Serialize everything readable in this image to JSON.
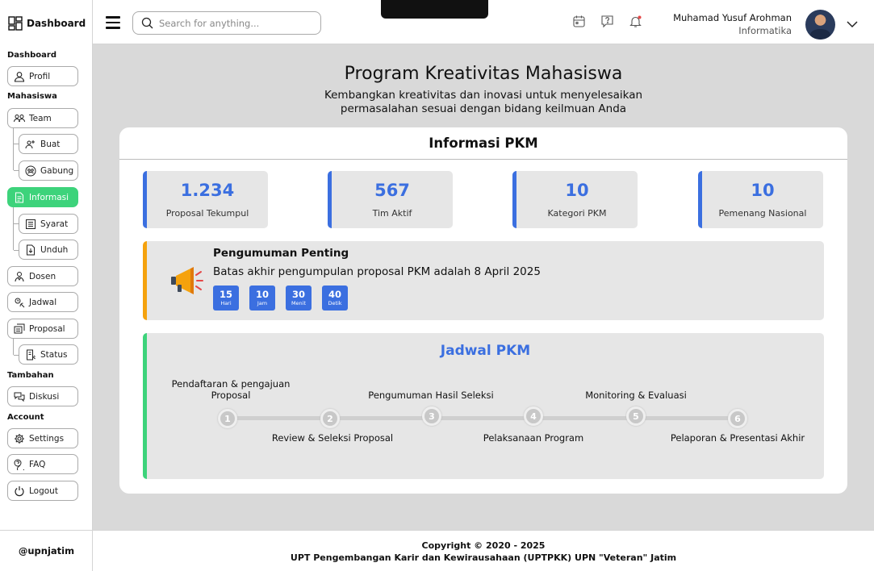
{
  "sidebar": {
    "logo_label": "Dashboard",
    "section_dashboard": "Dashboard",
    "section_mahasiswa": "Mahasiswa",
    "section_tambahan": "Tambahan",
    "section_account": "Account",
    "items": {
      "profil": "Profil",
      "team": "Team",
      "buat": "Buat",
      "gabung": "Gabung",
      "informasi": "Informasi",
      "syarat": "Syarat",
      "unduh": "Unduh",
      "dosen": "Dosen",
      "jadwal": "Jadwal",
      "proposal": "Proposal",
      "status": "Status",
      "diskusi": "Diskusi",
      "settings": "Settings",
      "faq": "FAQ",
      "logout": "Logout"
    },
    "footer": "@upnjatim",
    "active_color": "#3dd37b"
  },
  "header": {
    "search_placeholder": "Search for anything...",
    "user_name": "Muhamad Yusuf Arohman",
    "user_role": "Informatika"
  },
  "main": {
    "title": "Program Kreativitas Mahasiswa",
    "subtitle": "Kembangkan kreativitas dan inovasi untuk menyelesaikan permasalahan sesuai dengan bidang keilmuan Anda",
    "card_title": "Informasi PKM",
    "stats": [
      {
        "value": "1.234",
        "label": "Proposal Tekumpul"
      },
      {
        "value": "567",
        "label": "Tim Aktif"
      },
      {
        "value": "10",
        "label": "Kategori PKM"
      },
      {
        "value": "10",
        "label": "Pemenang Nasional"
      }
    ],
    "announcement": {
      "title": "Pengumuman Penting",
      "text": "Batas akhir pengumpulan proposal PKM adalah 8 April 2025",
      "countdown": [
        {
          "num": "15",
          "unit": "Hari"
        },
        {
          "num": "10",
          "unit": "Jam"
        },
        {
          "num": "30",
          "unit": "Menit"
        },
        {
          "num": "40",
          "unit": "Detik"
        }
      ]
    },
    "schedule": {
      "title": "Jadwal PKM",
      "steps": [
        {
          "num": "1",
          "label": "Pendaftaran & pengajuan Proposal"
        },
        {
          "num": "2",
          "label": "Review & Seleksi Proposal"
        },
        {
          "num": "3",
          "label": "Pengumuman Hasil Seleksi"
        },
        {
          "num": "4",
          "label": "Pelaksanaan Program"
        },
        {
          "num": "5",
          "label": "Monitoring & Evaluasi"
        },
        {
          "num": "6",
          "label": "Pelaporan & Presentasi Akhir"
        }
      ]
    },
    "accent_color": "#3b6fe0",
    "warning_color": "#f5a20d"
  },
  "footer": {
    "copyright": "Copyright © 2020 - 2025",
    "org": "UPT Pengembangan Karir dan Kewirausahaan (UPTPKK) UPN \"Veteran\" Jatim"
  }
}
